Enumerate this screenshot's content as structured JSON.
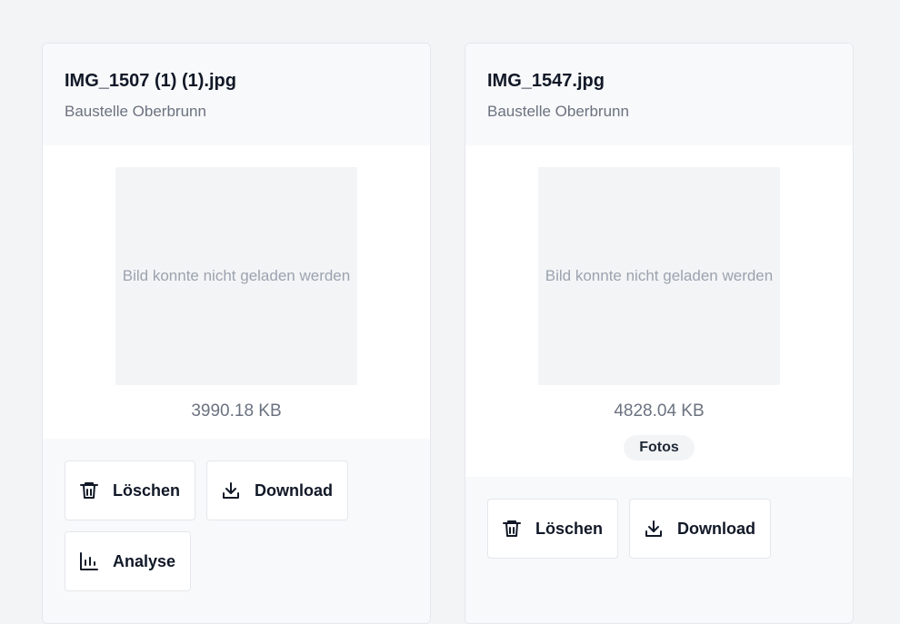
{
  "cards": [
    {
      "title": "IMG_1507 (1) (1).jpg",
      "subtitle": "Baustelle Oberbrunn",
      "preview_error": "Bild konnte nicht geladen werden",
      "size": "3990.18 KB",
      "tag": null,
      "buttons": {
        "delete": "Löschen",
        "download": "Download",
        "analyse": "Analyse"
      }
    },
    {
      "title": "IMG_1547.jpg",
      "subtitle": "Baustelle Oberbrunn",
      "preview_error": "Bild konnte nicht geladen werden",
      "size": "4828.04 KB",
      "tag": "Fotos",
      "buttons": {
        "delete": "Löschen",
        "download": "Download"
      }
    }
  ],
  "icons": {
    "delete": "trash-icon",
    "download": "download-icon",
    "analyse": "bar-chart-icon"
  }
}
